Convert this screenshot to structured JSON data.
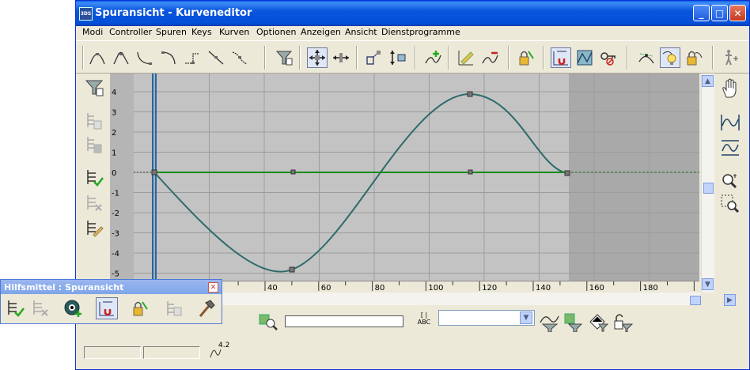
{
  "window": {
    "title": "Spuransicht - Kurveneditor",
    "icon_label": "3DS",
    "buttons": [
      "minimize-icon",
      "maximize-icon",
      "close-icon"
    ]
  },
  "menu": {
    "items": [
      "Modi",
      "Controller",
      "Spuren",
      "Keys",
      "Kurven",
      "Optionen",
      "Anzeigen",
      "Ansicht",
      "Dienstprogramme"
    ]
  },
  "toolbar": {
    "icons": [
      "tangent-auto-icon",
      "tangent-custom-icon",
      "tangent-fast-icon",
      "tangent-slow-icon",
      "tangent-step-icon",
      "tangent-linear-icon",
      "tangent-smooth-icon",
      "filter-icon",
      "move-keys-icon",
      "slide-keys-icon",
      "scale-keys-icon",
      "scale-values-icon",
      "add-keys-icon",
      "draw-curves-icon",
      "reduce-keys-icon",
      "lock-selection-icon",
      "snap-frames-icon",
      "parameter-curve-icon",
      "show-keyable-icon",
      "show-all-tangents-icon",
      "show-tangents-icon",
      "lock-tangents-icon",
      "biped-icon"
    ],
    "pressed": [
      "move-keys-icon",
      "snap-frames-icon",
      "show-tangents-icon"
    ]
  },
  "left_panel": {
    "icons": [
      "filter-icon",
      "copy-curve-icon",
      "paste-curve-icon",
      "assign-controller-icon",
      "delete-controller-icon",
      "edit-controller-icon"
    ]
  },
  "graph": {
    "y_ticks": [
      "4",
      "3",
      "2",
      "1",
      "0",
      "-1",
      "-2",
      "-3",
      "-4",
      "-5"
    ],
    "x_ticks": [
      "40",
      "60",
      "80",
      "100",
      "120",
      "140",
      "160",
      "180"
    ],
    "curve_color": "#2e6b6b",
    "flat_curve_color": "#1a8a1a",
    "active_range_color": "#c3c3c3",
    "inactive_range_color": "#a9a9a9"
  },
  "right_panel": {
    "icons": [
      "pan-hand-icon",
      "frame-horizontal-icon",
      "frame-values-icon",
      "zoom-icon",
      "zoom-region-icon"
    ]
  },
  "status": {
    "value_field": "",
    "selection_dropdown": "",
    "icons": [
      "select-by-name-icon",
      "zoom-selected-icon",
      "abc-edit-icon",
      "filter-selected-icon",
      "filter-animated-icon",
      "filter-unlocked-icon",
      "lock-keys-icon"
    ]
  },
  "key_stats": {
    "frame_field": "",
    "value_field": "",
    "stats_label": "4.2"
  },
  "toolbox": {
    "title": "Hilfsmittel : Spuransicht",
    "icons": [
      "assign-controller-icon",
      "delete-controller-icon",
      "show-keyable-add-icon",
      "snap-frames-icon",
      "lock-selection-icon",
      "parameter-curve-icon",
      "hammer-icon"
    ],
    "pressed": [
      "snap-frames-icon"
    ]
  }
}
